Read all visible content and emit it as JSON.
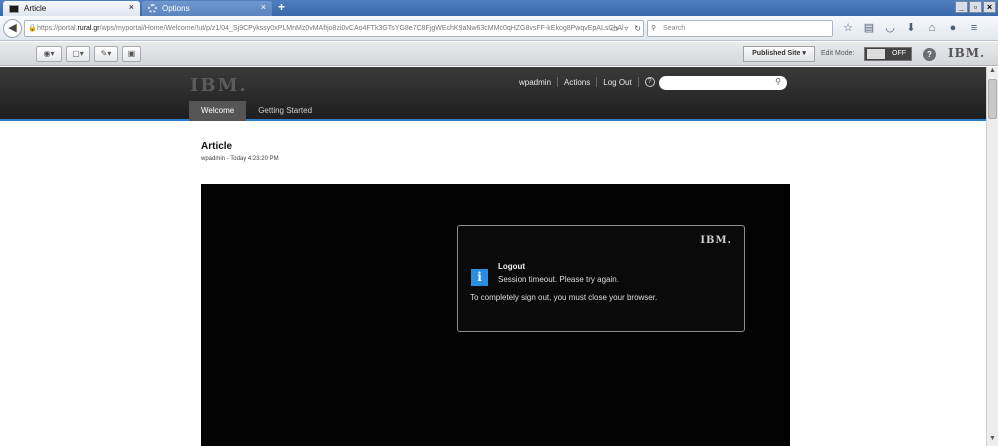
{
  "browser": {
    "tabs": [
      {
        "label": "Article",
        "active": true
      },
      {
        "label": "Options",
        "active": false
      }
    ],
    "new_tab_glyph": "+",
    "close_glyph": "×",
    "window_controls": [
      "_",
      "▫",
      "×"
    ],
    "url_prefix": "https://portal.",
    "url_domain": "rural.gr",
    "url_rest": "/wps/myportal/Home/Welcome/!ut/p/z1/04_Sj9CPykssy0xPLMnMz0vMAfIjo8zi0vCAo4FTk3GTsYG8e7C8FjgWEchK9aNw63cMMc0qHZG8vsFF-kEkog8PwqvEpALsChAl",
    "search_placeholder": "Search",
    "icons": [
      "star-icon",
      "bookmark-list-icon",
      "pocket-icon",
      "download-icon",
      "home-icon",
      "chat-icon",
      "menu-icon"
    ]
  },
  "toolbar": {
    "published_site_label": "Published Site ▾",
    "edit_mode_label": "Edit Mode:",
    "toggle_label": "OFF",
    "help_glyph": "?",
    "logo_text": "IBM."
  },
  "portal": {
    "logo_text": "IBM.",
    "user": "wpadmin",
    "actions": "Actions",
    "logout": "Log Out",
    "help_glyph": "?",
    "search_placeholder": "",
    "nav_tabs": [
      {
        "label": "Welcome",
        "active": true
      },
      {
        "label": "Getting Started",
        "active": false
      }
    ]
  },
  "article": {
    "title": "Article",
    "meta": "wpadmin - Today 4:23:20 PM"
  },
  "dialog": {
    "logo_text": "IBM.",
    "heading": "Logout",
    "message": "Session timeout. Please try again.",
    "note": "To completely sign out, you must close your browser.",
    "info_glyph": "i"
  },
  "colors": {
    "accent": "#2d7fc8",
    "header_bg": "#2b2b2b",
    "video_bg": "#030303",
    "info_icon": "#2a8fe0"
  }
}
